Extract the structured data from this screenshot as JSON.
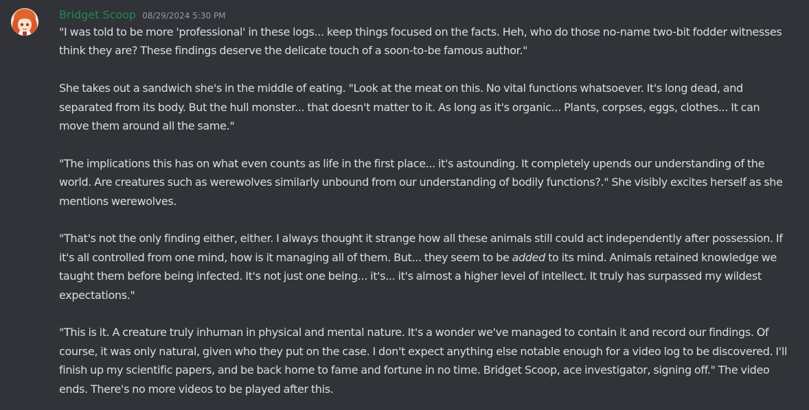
{
  "message": {
    "author": "Bridget Scoop",
    "author_color": "#1f8b4c",
    "timestamp": "08/29/2024 5:30 PM",
    "avatar_icon": "avatar-icon",
    "paragraphs": [
      "\"I was told to be more 'professional' in these logs... keep things focused on the facts. Heh, who do those no-name two-bit fodder witnesses think they are? These findings deserve the delicate touch of a soon-to-be famous author.\"",
      "She takes out a sandwich she's in the middle of eating. \"Look at the meat on this. No vital functions whatsoever. It's long dead, and separated from its body. But the hull monster... that doesn't matter to it. As long as it's organic... Plants, corpses, eggs, clothes... It can move them around all the same.\"",
      "\"The implications this has on what even counts as life in the first place... it's astounding. It completely upends our understanding of the world. Are creatures such as werewolves similarly unbound from our understanding of bodily functions?.\" She visibly excites herself as she mentions werewolves.",
      {
        "before": "\"That's not the only finding either, either. I always thought it strange how all these animals still could act independently after possession. If it's all controlled from one mind, how is it managing all of them. But... they seem to be ",
        "emphasis": "added",
        "after": " to its mind. Animals retained knowledge we taught them before being infected. It's not just one being... it's... it's almost a higher level of intellect. It truly has surpassed my wildest expectations.\""
      },
      "\"This is it. A creature truly inhuman in physical and mental nature. It's a wonder we've managed to contain it and record our findings. Of course, it was only natural, given who they put on the case. I don't expect anything else notable enough for a video log to be discovered. I'll finish up my scientific papers, and be back home to fame and fortune in no time. Bridget Scoop, ace investigator, signing off.\" The video ends. There's no more videos to be played after this."
    ]
  },
  "colors": {
    "background": "#313338",
    "text": "#dbdee1",
    "timestamp": "#949ba4"
  }
}
